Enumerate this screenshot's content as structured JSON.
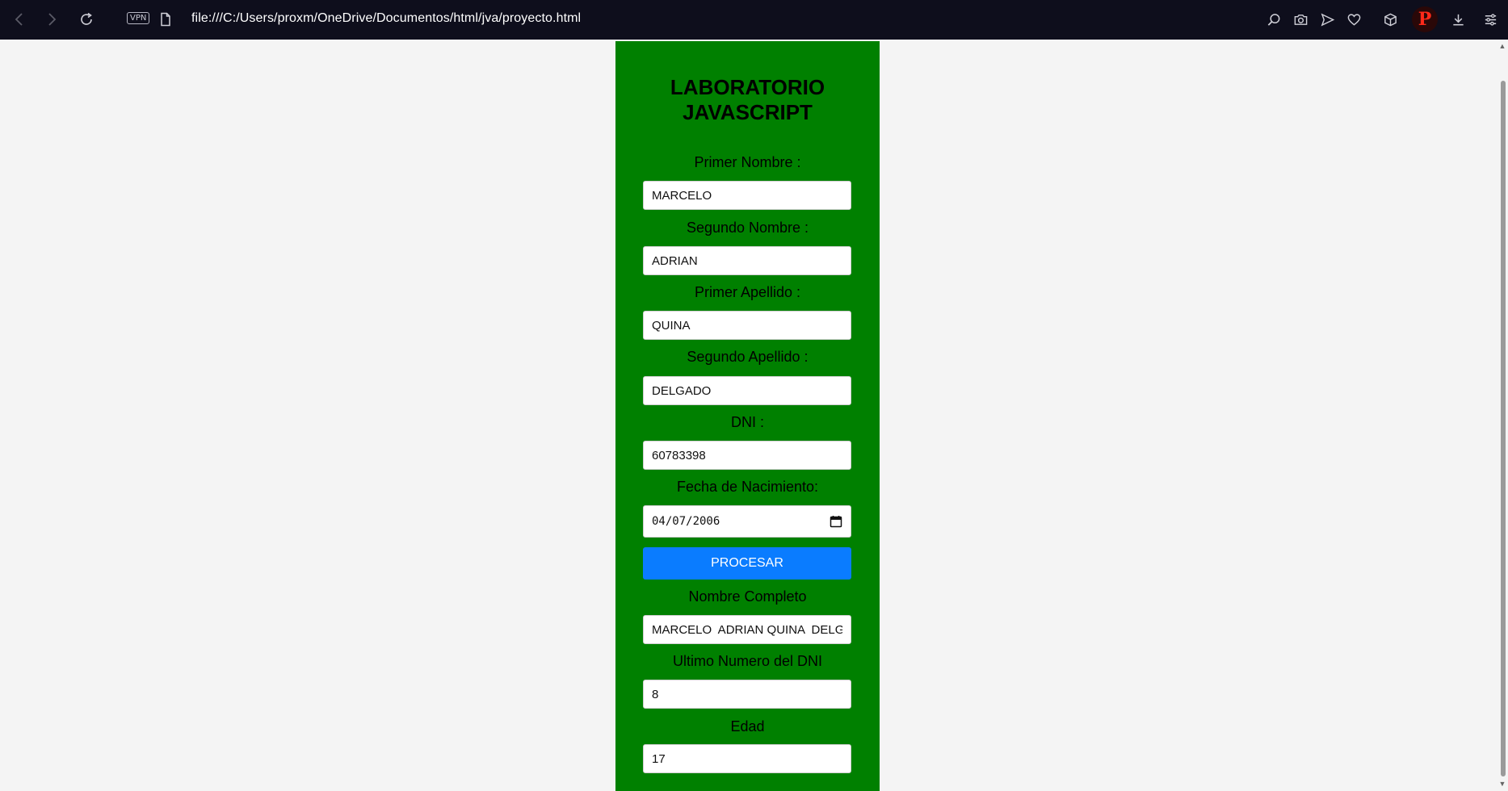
{
  "browser": {
    "url": "file:///C:/Users/proxm/OneDrive/Documentos/html/jva/proyecto.html",
    "vpn_label": "VPN",
    "profile_initial": "P"
  },
  "form": {
    "title_line1": "LABORATORIO",
    "title_line2": "JAVASCRIPT",
    "primer_nombre": {
      "label": "Primer Nombre :",
      "value": "MARCELO"
    },
    "segundo_nombre": {
      "label": "Segundo Nombre :",
      "value": "ADRIAN"
    },
    "primer_apellido": {
      "label": "Primer Apellido :",
      "value": "QUINA"
    },
    "segundo_apellido": {
      "label": "Segundo Apellido :",
      "value": "DELGADO"
    },
    "dni": {
      "label": "DNI :",
      "value": "60783398"
    },
    "fecha_nacimiento": {
      "label": "Fecha de Nacimiento:",
      "value": "04/07/2006"
    },
    "procesar_label": "PROCESAR",
    "nombre_completo": {
      "label": "Nombre Completo",
      "value": "MARCELO  ADRIAN QUINA  DELGADO"
    },
    "ultimo_numero_dni": {
      "label": "Ultimo Numero del DNI",
      "value": "8"
    },
    "edad": {
      "label": "Edad",
      "value": "17"
    }
  },
  "colors": {
    "panel_bg": "#008000",
    "button_bg": "#0a7cff",
    "browser_bar_bg": "#0e0e1c",
    "page_bg": "#f4f4f4"
  }
}
